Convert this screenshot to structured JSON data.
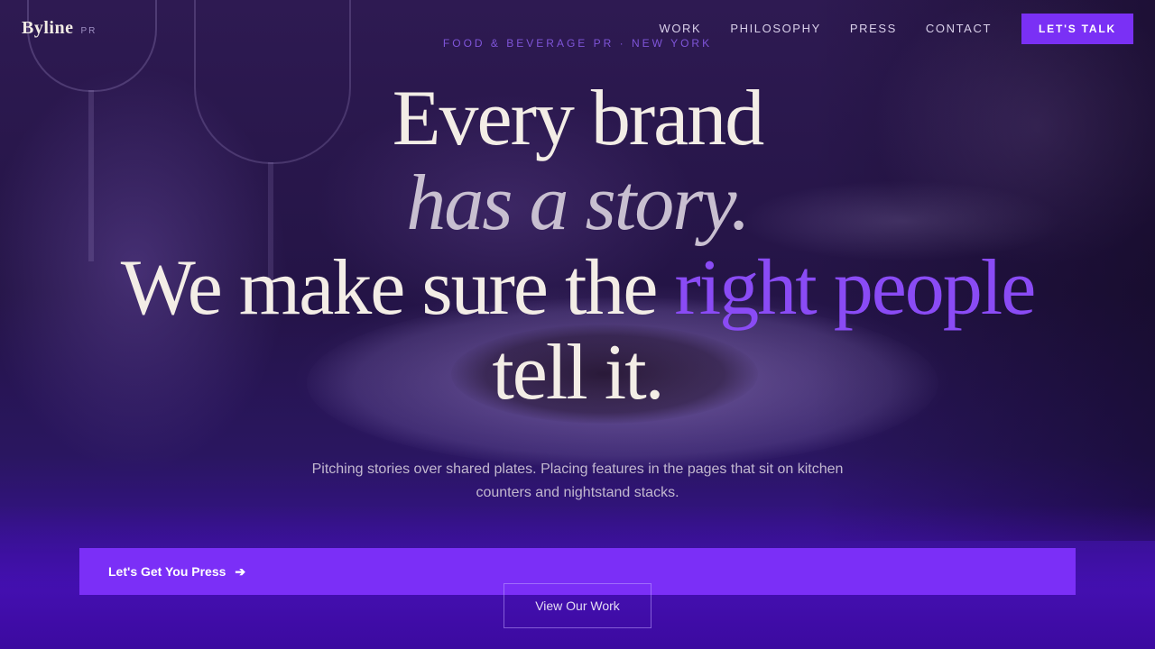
{
  "brand": {
    "name": "Byline",
    "suffix": "PR"
  },
  "nav": {
    "items": [
      {
        "label": "WORK"
      },
      {
        "label": "PHILOSOPHY"
      },
      {
        "label": "PRESS"
      },
      {
        "label": "CONTACT"
      }
    ],
    "cta_label": "LET'S TALK"
  },
  "hero": {
    "eyebrow": "FOOD & BEVERAGE PR · NEW YORK",
    "headline": {
      "line1": "Every brand",
      "line2": "has a story.",
      "line3_prefix": "We make sure the ",
      "line3_accent": "right people",
      "line4": "tell it."
    },
    "lede": "Pitching stories over shared plates. Placing features in the pages that sit on kitchen counters and nightstand stacks.",
    "primary_cta": "Let's Get You Press",
    "primary_cta_icon": "arrow-right-icon",
    "secondary_cta": "View Our Work"
  },
  "colors": {
    "accent": "#7b2ff7",
    "accent_text": "#8a4bf5",
    "headline": "#f3ede6",
    "eyebrow": "#7f55d9"
  }
}
